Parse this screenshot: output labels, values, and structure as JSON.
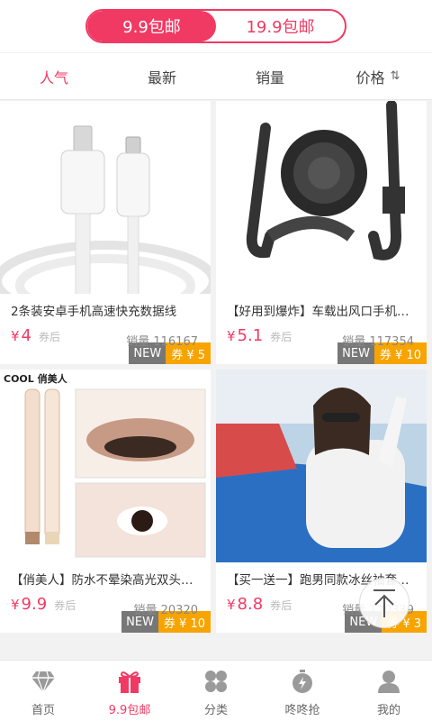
{
  "header": {
    "segments": [
      "9.9包邮",
      "19.9包邮"
    ],
    "active_segment": 0
  },
  "sort": {
    "items": [
      "人气",
      "最新",
      "销量",
      "价格"
    ],
    "price_arrow": "⇅",
    "active": 0
  },
  "products": [
    {
      "title": "2条装安卓手机高速快充数据线",
      "price": "4",
      "currency": "¥",
      "after": "券后",
      "sales": "销量 116167",
      "new": "NEW",
      "coupon": "券 ¥ 5",
      "icon": "usb-cable-image"
    },
    {
      "title": "【好用到爆炸】车载出风口手机支架",
      "price": "5.1",
      "currency": "¥",
      "after": "券后",
      "sales": "销量 117354",
      "new": "NEW",
      "coupon": "券 ¥ 10",
      "icon": "phone-holder-image"
    },
    {
      "title": "【俏美人】防水不晕染高光双头眼影笔",
      "price": "9.9",
      "currency": "¥",
      "after": "券后",
      "sales": "销量 20320",
      "new": "NEW",
      "coupon": "券 ¥ 10",
      "icon": "eyeshadow-image",
      "brand": "COOL 俏美人"
    },
    {
      "title": "【买一送一】跑男同款冰丝袖套防晒",
      "price": "8.8",
      "currency": "¥",
      "after": "券后",
      "sales": "销量 120339",
      "new": "NEW",
      "coupon": "券 ¥ 3",
      "icon": "ice-sleeve-image"
    }
  ],
  "tabbar": {
    "items": [
      {
        "label": "首页",
        "icon": "diamond-icon"
      },
      {
        "label": "9.9包邮",
        "icon": "gift-icon"
      },
      {
        "label": "分类",
        "icon": "category-icon"
      },
      {
        "label": "咚咚抢",
        "icon": "timer-icon"
      },
      {
        "label": "我的",
        "icon": "user-icon"
      }
    ],
    "active": 1
  },
  "colors": {
    "accent": "#f03a63",
    "coupon": "#f7a400",
    "new_badge": "#777777"
  }
}
